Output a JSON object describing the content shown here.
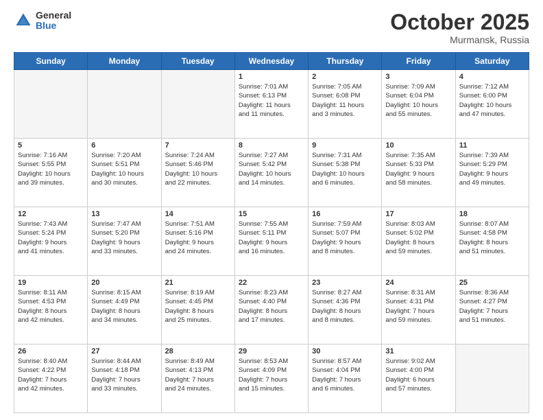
{
  "header": {
    "logo_general": "General",
    "logo_blue": "Blue",
    "month": "October 2025",
    "location": "Murmansk, Russia"
  },
  "days_of_week": [
    "Sunday",
    "Monday",
    "Tuesday",
    "Wednesday",
    "Thursday",
    "Friday",
    "Saturday"
  ],
  "weeks": [
    [
      {
        "day": "",
        "content": ""
      },
      {
        "day": "",
        "content": ""
      },
      {
        "day": "",
        "content": ""
      },
      {
        "day": "1",
        "content": "Sunrise: 7:01 AM\nSunset: 6:13 PM\nDaylight: 11 hours\nand 11 minutes."
      },
      {
        "day": "2",
        "content": "Sunrise: 7:05 AM\nSunset: 6:08 PM\nDaylight: 11 hours\nand 3 minutes."
      },
      {
        "day": "3",
        "content": "Sunrise: 7:09 AM\nSunset: 6:04 PM\nDaylight: 10 hours\nand 55 minutes."
      },
      {
        "day": "4",
        "content": "Sunrise: 7:12 AM\nSunset: 6:00 PM\nDaylight: 10 hours\nand 47 minutes."
      }
    ],
    [
      {
        "day": "5",
        "content": "Sunrise: 7:16 AM\nSunset: 5:55 PM\nDaylight: 10 hours\nand 39 minutes."
      },
      {
        "day": "6",
        "content": "Sunrise: 7:20 AM\nSunset: 5:51 PM\nDaylight: 10 hours\nand 30 minutes."
      },
      {
        "day": "7",
        "content": "Sunrise: 7:24 AM\nSunset: 5:46 PM\nDaylight: 10 hours\nand 22 minutes."
      },
      {
        "day": "8",
        "content": "Sunrise: 7:27 AM\nSunset: 5:42 PM\nDaylight: 10 hours\nand 14 minutes."
      },
      {
        "day": "9",
        "content": "Sunrise: 7:31 AM\nSunset: 5:38 PM\nDaylight: 10 hours\nand 6 minutes."
      },
      {
        "day": "10",
        "content": "Sunrise: 7:35 AM\nSunset: 5:33 PM\nDaylight: 9 hours\nand 58 minutes."
      },
      {
        "day": "11",
        "content": "Sunrise: 7:39 AM\nSunset: 5:29 PM\nDaylight: 9 hours\nand 49 minutes."
      }
    ],
    [
      {
        "day": "12",
        "content": "Sunrise: 7:43 AM\nSunset: 5:24 PM\nDaylight: 9 hours\nand 41 minutes."
      },
      {
        "day": "13",
        "content": "Sunrise: 7:47 AM\nSunset: 5:20 PM\nDaylight: 9 hours\nand 33 minutes."
      },
      {
        "day": "14",
        "content": "Sunrise: 7:51 AM\nSunset: 5:16 PM\nDaylight: 9 hours\nand 24 minutes."
      },
      {
        "day": "15",
        "content": "Sunrise: 7:55 AM\nSunset: 5:11 PM\nDaylight: 9 hours\nand 16 minutes."
      },
      {
        "day": "16",
        "content": "Sunrise: 7:59 AM\nSunset: 5:07 PM\nDaylight: 9 hours\nand 8 minutes."
      },
      {
        "day": "17",
        "content": "Sunrise: 8:03 AM\nSunset: 5:02 PM\nDaylight: 8 hours\nand 59 minutes."
      },
      {
        "day": "18",
        "content": "Sunrise: 8:07 AM\nSunset: 4:58 PM\nDaylight: 8 hours\nand 51 minutes."
      }
    ],
    [
      {
        "day": "19",
        "content": "Sunrise: 8:11 AM\nSunset: 4:53 PM\nDaylight: 8 hours\nand 42 minutes."
      },
      {
        "day": "20",
        "content": "Sunrise: 8:15 AM\nSunset: 4:49 PM\nDaylight: 8 hours\nand 34 minutes."
      },
      {
        "day": "21",
        "content": "Sunrise: 8:19 AM\nSunset: 4:45 PM\nDaylight: 8 hours\nand 25 minutes."
      },
      {
        "day": "22",
        "content": "Sunrise: 8:23 AM\nSunset: 4:40 PM\nDaylight: 8 hours\nand 17 minutes."
      },
      {
        "day": "23",
        "content": "Sunrise: 8:27 AM\nSunset: 4:36 PM\nDaylight: 8 hours\nand 8 minutes."
      },
      {
        "day": "24",
        "content": "Sunrise: 8:31 AM\nSunset: 4:31 PM\nDaylight: 7 hours\nand 59 minutes."
      },
      {
        "day": "25",
        "content": "Sunrise: 8:36 AM\nSunset: 4:27 PM\nDaylight: 7 hours\nand 51 minutes."
      }
    ],
    [
      {
        "day": "26",
        "content": "Sunrise: 8:40 AM\nSunset: 4:22 PM\nDaylight: 7 hours\nand 42 minutes."
      },
      {
        "day": "27",
        "content": "Sunrise: 8:44 AM\nSunset: 4:18 PM\nDaylight: 7 hours\nand 33 minutes."
      },
      {
        "day": "28",
        "content": "Sunrise: 8:49 AM\nSunset: 4:13 PM\nDaylight: 7 hours\nand 24 minutes."
      },
      {
        "day": "29",
        "content": "Sunrise: 8:53 AM\nSunset: 4:09 PM\nDaylight: 7 hours\nand 15 minutes."
      },
      {
        "day": "30",
        "content": "Sunrise: 8:57 AM\nSunset: 4:04 PM\nDaylight: 7 hours\nand 6 minutes."
      },
      {
        "day": "31",
        "content": "Sunrise: 9:02 AM\nSunset: 4:00 PM\nDaylight: 6 hours\nand 57 minutes."
      },
      {
        "day": "",
        "content": ""
      }
    ]
  ]
}
